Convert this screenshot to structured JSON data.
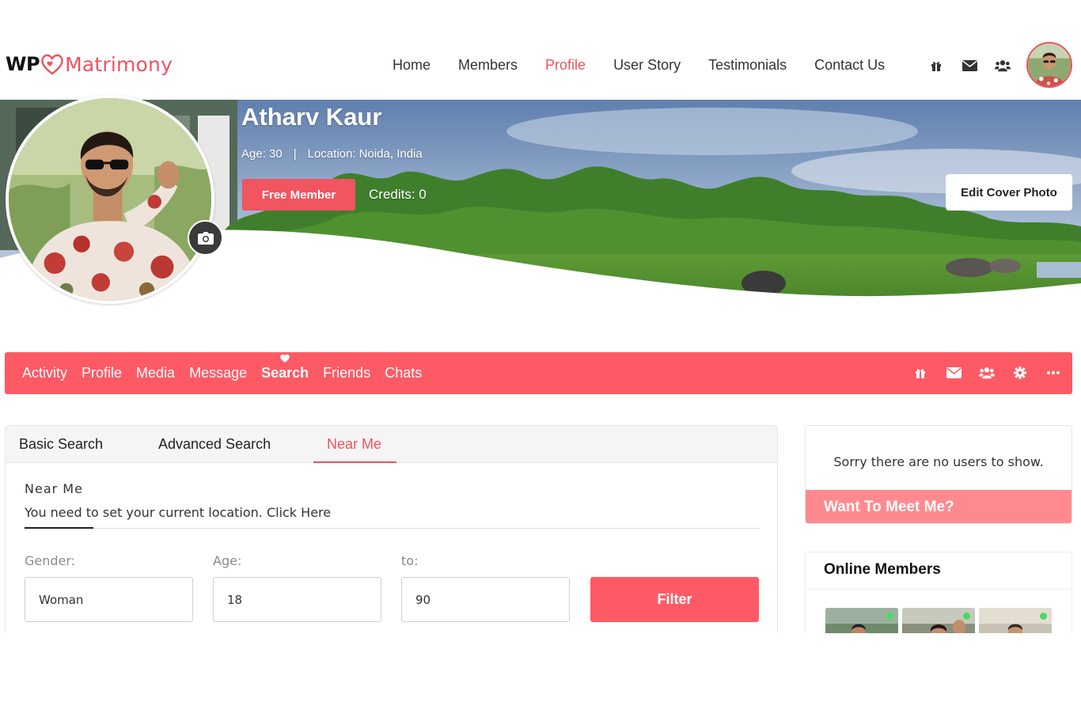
{
  "brand": {
    "prefix": "WP",
    "name": "Matrimony"
  },
  "main_nav": [
    "Home",
    "Members",
    "Profile",
    "User Story",
    "Testimonials",
    "Contact Us"
  ],
  "main_nav_active": "Profile",
  "header_icons": [
    "gift-icon",
    "envelope-icon",
    "users-icon"
  ],
  "profile": {
    "name": "Atharv Kaur",
    "age": "Age: 30",
    "separator": "|",
    "location": "Location: Noida, India",
    "membership": "Free Member",
    "credits": "Credits: 0",
    "edit_cover": "Edit Cover Photo"
  },
  "profile_tabs": [
    "Activity",
    "Profile",
    "Media",
    "Message",
    "Search",
    "Friends",
    "Chats"
  ],
  "profile_tabs_active": "Search",
  "profile_bar_icons": [
    "gift-icon",
    "envelope-icon",
    "users-icon",
    "gear-icon",
    "more-icon"
  ],
  "search": {
    "tabs": [
      "Basic Search",
      "Advanced Search",
      "Near Me"
    ],
    "active_tab": "Near Me",
    "section_title": "Near Me",
    "location_message": "You need to set your current location. Click Here",
    "gender_label": "Gender:",
    "gender_value": "Woman",
    "age_label": "Age:",
    "age_from": "18",
    "to_label": "to:",
    "age_to": "90",
    "filter_label": "Filter"
  },
  "sidebar": {
    "no_users": "Sorry there are no users to show.",
    "want_to_meet": "Want To Meet Me?",
    "online_title": "Online Members",
    "online_count_shown": 3
  },
  "colors": {
    "accent": "#fe5a65",
    "accent_light": "#fe8a8f",
    "text": "#333333"
  }
}
